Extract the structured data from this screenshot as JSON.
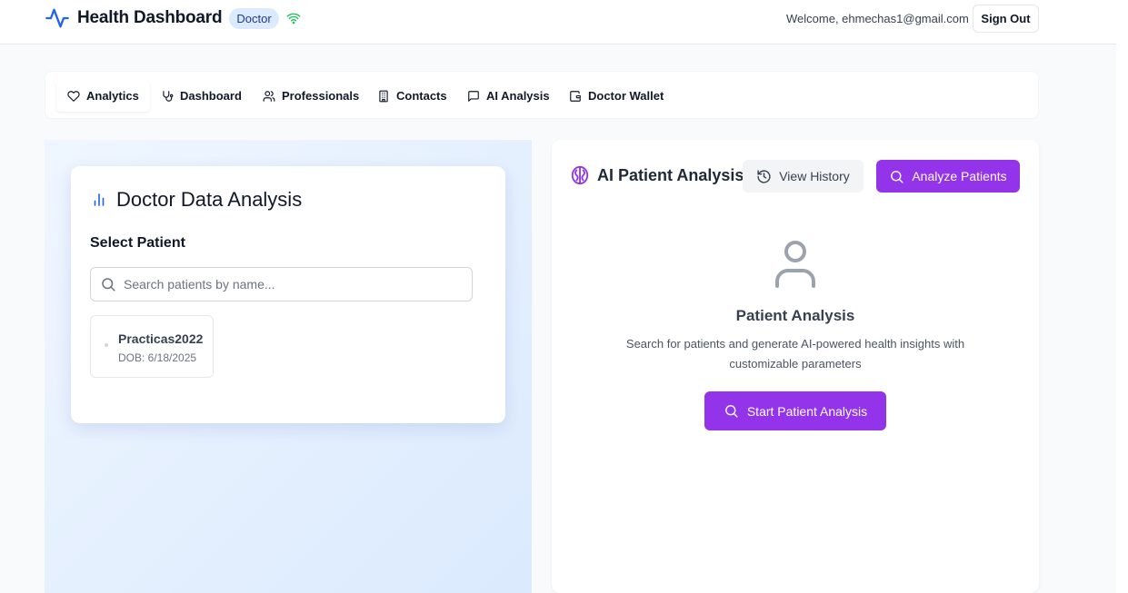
{
  "header": {
    "brand_title": "Health Dashboard",
    "role_badge": "Doctor",
    "welcome_text": "Welcome, ehmechas1@gmail.com",
    "sign_out_label": "Sign Out",
    "brand_icon": "activity-icon",
    "status_icon": "wifi-icon"
  },
  "nav": {
    "items": [
      {
        "label": "Analytics",
        "icon": "heart-icon",
        "active": true
      },
      {
        "label": "Dashboard",
        "icon": "stethoscope-icon",
        "active": false
      },
      {
        "label": "Professionals",
        "icon": "users-icon",
        "active": false
      },
      {
        "label": "Contacts",
        "icon": "building-icon",
        "active": false
      },
      {
        "label": "AI Analysis",
        "icon": "message-square-icon",
        "active": false
      },
      {
        "label": "Doctor Wallet",
        "icon": "wallet-icon",
        "active": false
      }
    ]
  },
  "doctor_analysis": {
    "title": "Doctor Data Analysis",
    "icon": "bar-chart-icon",
    "select_label": "Select Patient",
    "search_placeholder": "Search patients by name...",
    "search_value": "",
    "patients": [
      {
        "name": "Practicas2022",
        "dob": "DOB: 6/18/2025"
      }
    ]
  },
  "ai_analysis": {
    "title": "AI Patient Analysis",
    "icon": "brain-icon",
    "view_history_label": "View History",
    "analyze_label": "Analyze Patients",
    "empty_title": "Patient Analysis",
    "empty_description": "Search for patients and generate AI-powered health insights with customizable parameters",
    "start_label": "Start Patient Analysis"
  },
  "colors": {
    "brand_blue": "#2563eb",
    "purple": "#9333ea",
    "badge_bg": "#dbeafe",
    "wifi_green": "#22c55e"
  }
}
